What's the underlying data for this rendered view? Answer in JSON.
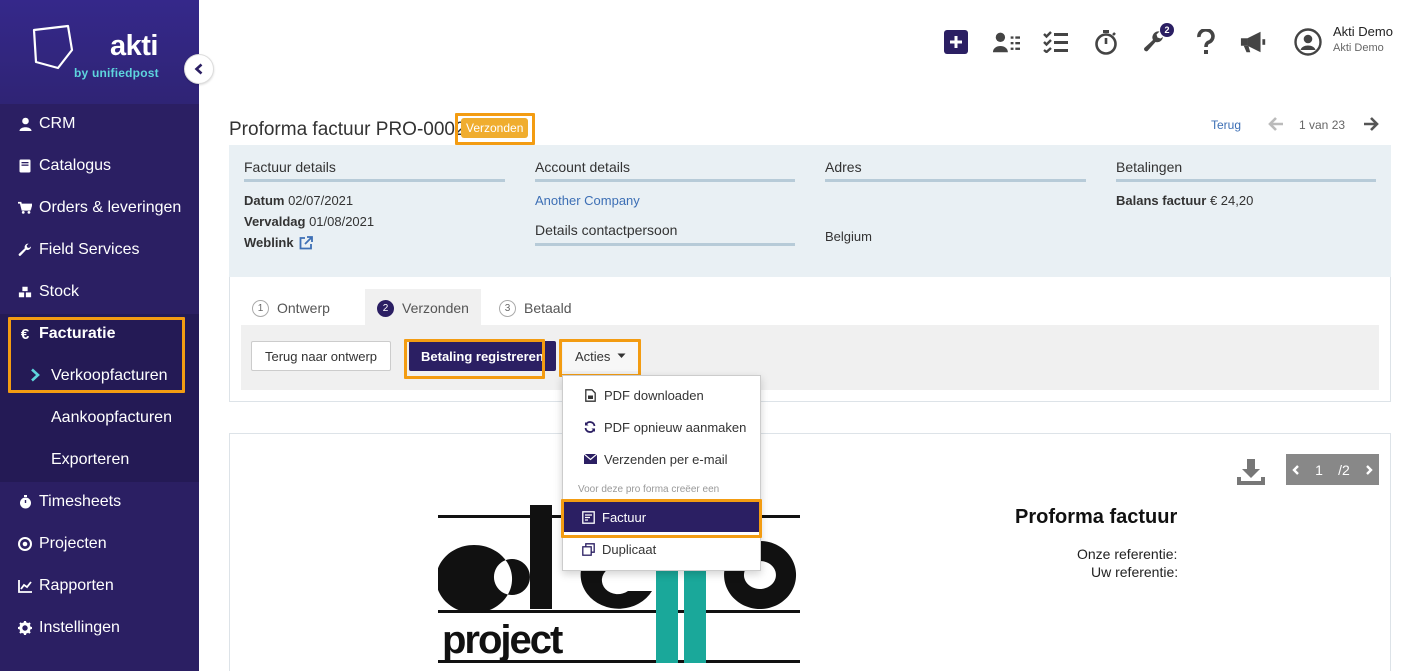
{
  "brand": {
    "name": "akti",
    "sub": "by unifiedpost"
  },
  "sidebar": {
    "items": [
      {
        "label": "CRM",
        "icon": "user-icon"
      },
      {
        "label": "Catalogus",
        "icon": "book-icon"
      },
      {
        "label": "Orders & leveringen",
        "icon": "cart-icon"
      },
      {
        "label": "Field Services",
        "icon": "wrench-icon"
      },
      {
        "label": "Stock",
        "icon": "cubes-icon"
      },
      {
        "label": "Facturatie",
        "icon": "euro-icon"
      },
      {
        "label": "Timesheets",
        "icon": "stopwatch-icon"
      },
      {
        "label": "Projecten",
        "icon": "target-icon"
      },
      {
        "label": "Rapporten",
        "icon": "chart-icon"
      },
      {
        "label": "Instellingen",
        "icon": "gear-icon"
      }
    ],
    "sub": [
      {
        "label": "Verkoopfacturen"
      },
      {
        "label": "Aankoopfacturen"
      },
      {
        "label": "Exporteren"
      }
    ]
  },
  "header": {
    "user_name": "Akti Demo",
    "user_company": "Akti Demo",
    "tools_badge": "2"
  },
  "page": {
    "title": "Proforma factuur PRO-0002",
    "status": "Verzonden",
    "back": "Terug",
    "pager": "1 van 23"
  },
  "details": {
    "invoice": {
      "header": "Factuur details",
      "datum_label": "Datum",
      "datum": "02/07/2021",
      "vervaldag_label": "Vervaldag",
      "vervaldag": "01/08/2021",
      "weblink_label": "Weblink"
    },
    "account": {
      "header": "Account details",
      "company": "Another Company",
      "contact_header": "Details contactpersoon"
    },
    "address": {
      "header": "Adres",
      "country": "Belgium"
    },
    "payments": {
      "header": "Betalingen",
      "balance_label": "Balans factuur",
      "balance": "€ 24,20"
    }
  },
  "workflow": {
    "steps": [
      {
        "num": "1",
        "label": "Ontwerp"
      },
      {
        "num": "2",
        "label": "Verzonden"
      },
      {
        "num": "3",
        "label": "Betaald"
      }
    ],
    "back_button": "Terug naar ontwerp",
    "register_button": "Betaling registreren",
    "actions_button": "Acties"
  },
  "dropdown": {
    "items": [
      {
        "label": "PDF downloaden",
        "icon": "pdf-icon"
      },
      {
        "label": "PDF opnieuw aanmaken",
        "icon": "refresh-icon"
      },
      {
        "label": "Verzenden per e-mail",
        "icon": "envelope-icon"
      }
    ],
    "section_header": "Voor deze pro forma creëer een",
    "create": [
      {
        "label": "Factuur",
        "icon": "invoice-icon"
      },
      {
        "label": "Duplicaat",
        "icon": "copy-icon"
      }
    ]
  },
  "document": {
    "page_current": "1",
    "page_total": "/2",
    "title": "Proforma factuur",
    "ref_ours": "Onze referentie:",
    "ref_yours": "Uw referentie:",
    "logo_text": "demo project"
  },
  "colors": {
    "sidebar": "#2b1f63",
    "highlight": "#f39c12",
    "accent_teal": "#1aa89a",
    "link": "#3d6fb5"
  }
}
